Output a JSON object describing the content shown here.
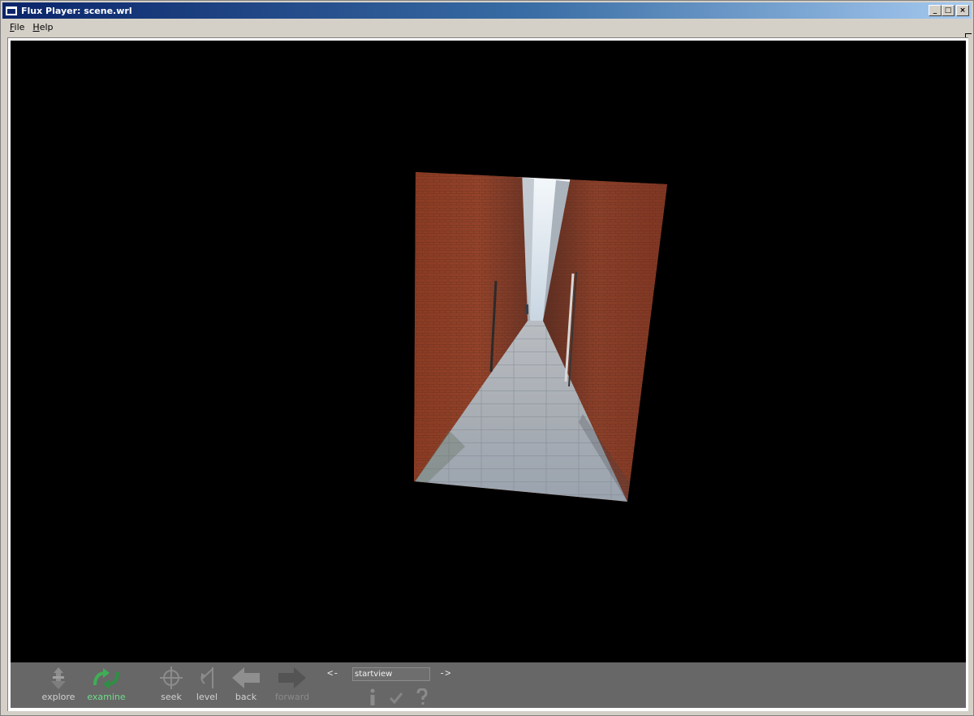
{
  "window": {
    "title": "Flux Player: scene.wrl",
    "controls": {
      "minimize": "_",
      "maximize": "□",
      "close": "×"
    }
  },
  "menu": {
    "items": [
      {
        "label": "File",
        "accel": "F",
        "rest": "ile"
      },
      {
        "label": "Help",
        "accel": "H",
        "rest": "elp"
      }
    ]
  },
  "viewport": {
    "background": "#000000",
    "scene": "brick-alley-photo-texture"
  },
  "toolbar": {
    "buttons": [
      {
        "id": "explore",
        "label": "explore",
        "state": "normal",
        "icon": "explore-icon"
      },
      {
        "id": "examine",
        "label": "examine",
        "state": "active",
        "icon": "examine-icon"
      },
      {
        "id": "seek",
        "label": "seek",
        "state": "normal",
        "icon": "seek-icon"
      },
      {
        "id": "level",
        "label": "level",
        "state": "normal",
        "icon": "level-icon"
      },
      {
        "id": "back",
        "label": "back",
        "state": "normal",
        "icon": "back-arrow-icon"
      },
      {
        "id": "forward",
        "label": "forward",
        "state": "disabled",
        "icon": "forward-arrow-icon"
      }
    ],
    "viewpoint": {
      "prev_label": "<-",
      "next_label": "->",
      "value": "startview"
    },
    "colors": {
      "background": "#676767",
      "label": "#d0d0d0",
      "active": "#6fdc8a",
      "disabled": "#8a8a8a"
    }
  }
}
